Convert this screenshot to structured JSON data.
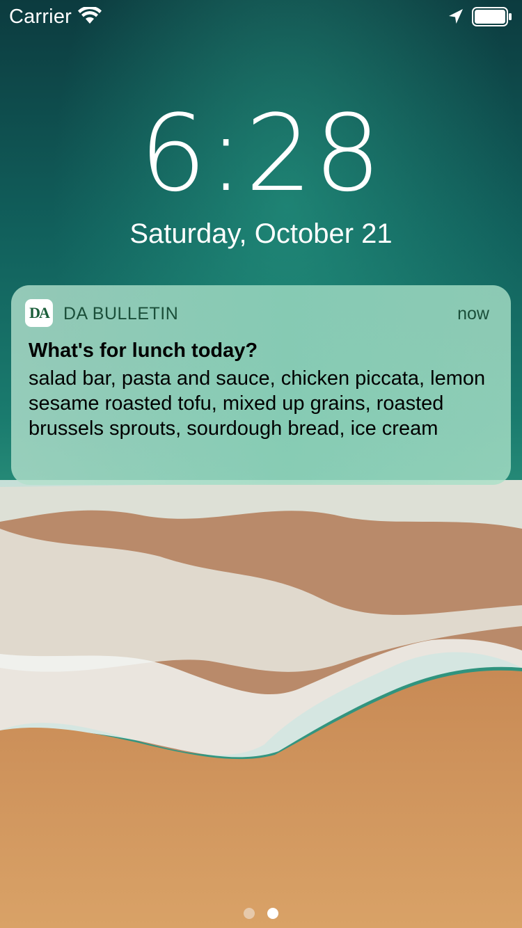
{
  "status_bar": {
    "carrier": "Carrier",
    "wifi_icon": "wifi-icon",
    "location_icon": "location-arrow-icon",
    "battery_icon": "battery-icon"
  },
  "lock_screen": {
    "time": "6:28",
    "date": "Saturday, October 21"
  },
  "notification": {
    "app_icon": "da-bulletin-logo",
    "app_icon_text": "DA",
    "app_name": "DA BULLETIN",
    "timestamp": "now",
    "title": "What's for lunch today?",
    "body": "salad bar, pasta and sauce, chicken piccata, lemon sesame roasted tofu, mixed up grains, roasted brussels sprouts, sourdough bread, ice cream",
    "accent_color": "#1b5e3a"
  },
  "page_indicator": {
    "count": 2,
    "active_index": 1
  }
}
